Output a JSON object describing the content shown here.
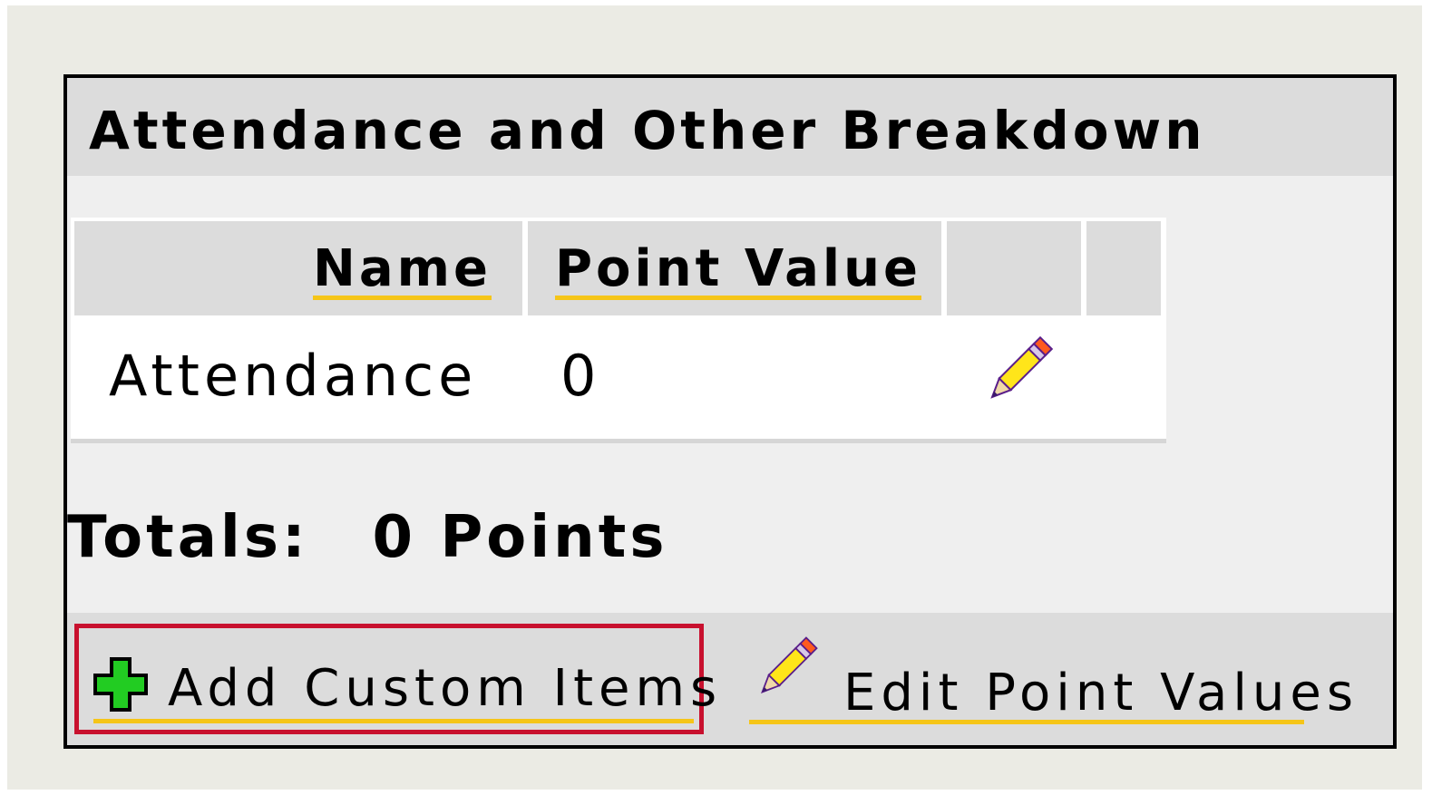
{
  "panel": {
    "title": "Attendance and Other Breakdown"
  },
  "table": {
    "columns": [
      "Name",
      "Point Value",
      "",
      ""
    ],
    "rows": [
      {
        "name": "Attendance",
        "point_value": "0",
        "edit_icon": "pencil-icon"
      }
    ]
  },
  "totals": {
    "label": "Totals:",
    "value": "0 Points"
  },
  "footer": {
    "add_label": "Add Custom Items",
    "add_icon": "plus-icon",
    "edit_label": "Edit Point Values",
    "edit_icon": "pencil-icon"
  },
  "colors": {
    "header_bg": "#dcdcdc",
    "panel_bg": "#efefef",
    "link_underline": "#f5c518",
    "highlight_border": "#c8102e",
    "plus_green": "#22cc22"
  }
}
